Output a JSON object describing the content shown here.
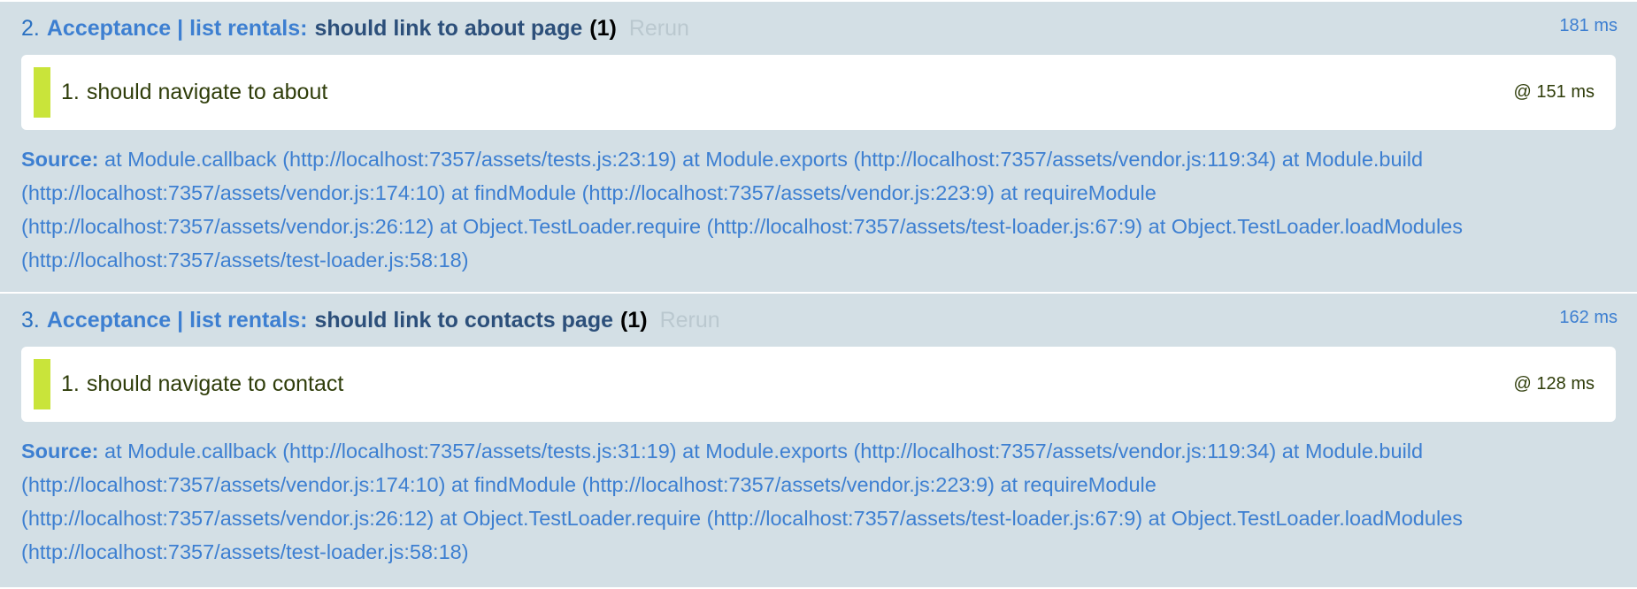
{
  "tests": [
    {
      "number": "2.",
      "module": "Acceptance | list rentals:",
      "name": "should link to about page",
      "counts": "(1)",
      "rerun": "Rerun",
      "runtime": "181 ms",
      "assertion": {
        "number": "1.",
        "text": "should navigate to about",
        "time": "@ 151 ms"
      },
      "source_label": "Source:",
      "source_lines": [
        "at Module.callback (http://localhost:7357/assets/tests.js:23:19) at Module.exports (http://localhost:7357/assets/vendor.js:119:34) at Module.build",
        "(http://localhost:7357/assets/vendor.js:174:10) at findModule (http://localhost:7357/assets/vendor.js:223:9) at requireModule",
        "(http://localhost:7357/assets/vendor.js:26:12) at Object.TestLoader.require (http://localhost:7357/assets/test-loader.js:67:9) at Object.TestLoader.loadModules",
        "(http://localhost:7357/assets/test-loader.js:58:18)"
      ]
    },
    {
      "number": "3.",
      "module": "Acceptance | list rentals:",
      "name": "should link to contacts page",
      "counts": "(1)",
      "rerun": "Rerun",
      "runtime": "162 ms",
      "assertion": {
        "number": "1.",
        "text": "should navigate to contact",
        "time": "@ 128 ms"
      },
      "source_label": "Source:",
      "source_lines": [
        "at Module.callback (http://localhost:7357/assets/tests.js:31:19) at Module.exports (http://localhost:7357/assets/vendor.js:119:34) at Module.build",
        "(http://localhost:7357/assets/vendor.js:174:10) at findModule (http://localhost:7357/assets/vendor.js:223:9) at requireModule",
        "(http://localhost:7357/assets/vendor.js:26:12) at Object.TestLoader.require (http://localhost:7357/assets/test-loader.js:67:9) at Object.TestLoader.loadModules",
        "(http://localhost:7357/assets/test-loader.js:58:18)"
      ]
    }
  ],
  "colors": {
    "row_background": "#d3dfe5",
    "module_blue": "#3d7fd1",
    "test_name": "#2c4f7a",
    "rerun_gray": "#bac8cf",
    "pass_bar": "#c9e43a",
    "assert_text": "#2f3d0a"
  }
}
